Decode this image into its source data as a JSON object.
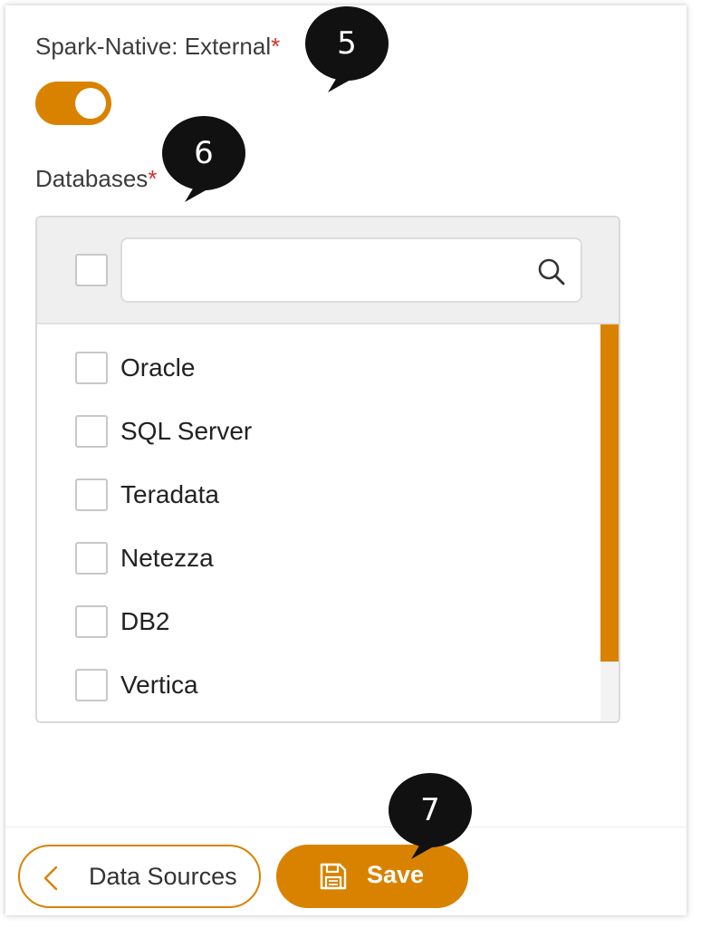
{
  "colors": {
    "accent": "#d98200",
    "callout": "#111111",
    "required": "#d0312d"
  },
  "spark_native": {
    "label": "Spark-Native: External",
    "required_mark": "*",
    "toggle_on": true
  },
  "databases": {
    "label": "Databases",
    "required_mark": "*",
    "search": {
      "value": "",
      "placeholder": ""
    },
    "items": [
      {
        "label": "Oracle",
        "checked": false
      },
      {
        "label": "SQL Server",
        "checked": false
      },
      {
        "label": "Teradata",
        "checked": false
      },
      {
        "label": "Netezza",
        "checked": false
      },
      {
        "label": "DB2",
        "checked": false
      },
      {
        "label": "Vertica",
        "checked": false
      }
    ]
  },
  "callouts": [
    "5",
    "6",
    "7"
  ],
  "footer": {
    "back_label": "Data Sources",
    "back_icon": "chevron-left-icon",
    "save_label": "Save",
    "save_icon": "floppy-disk-icon"
  }
}
